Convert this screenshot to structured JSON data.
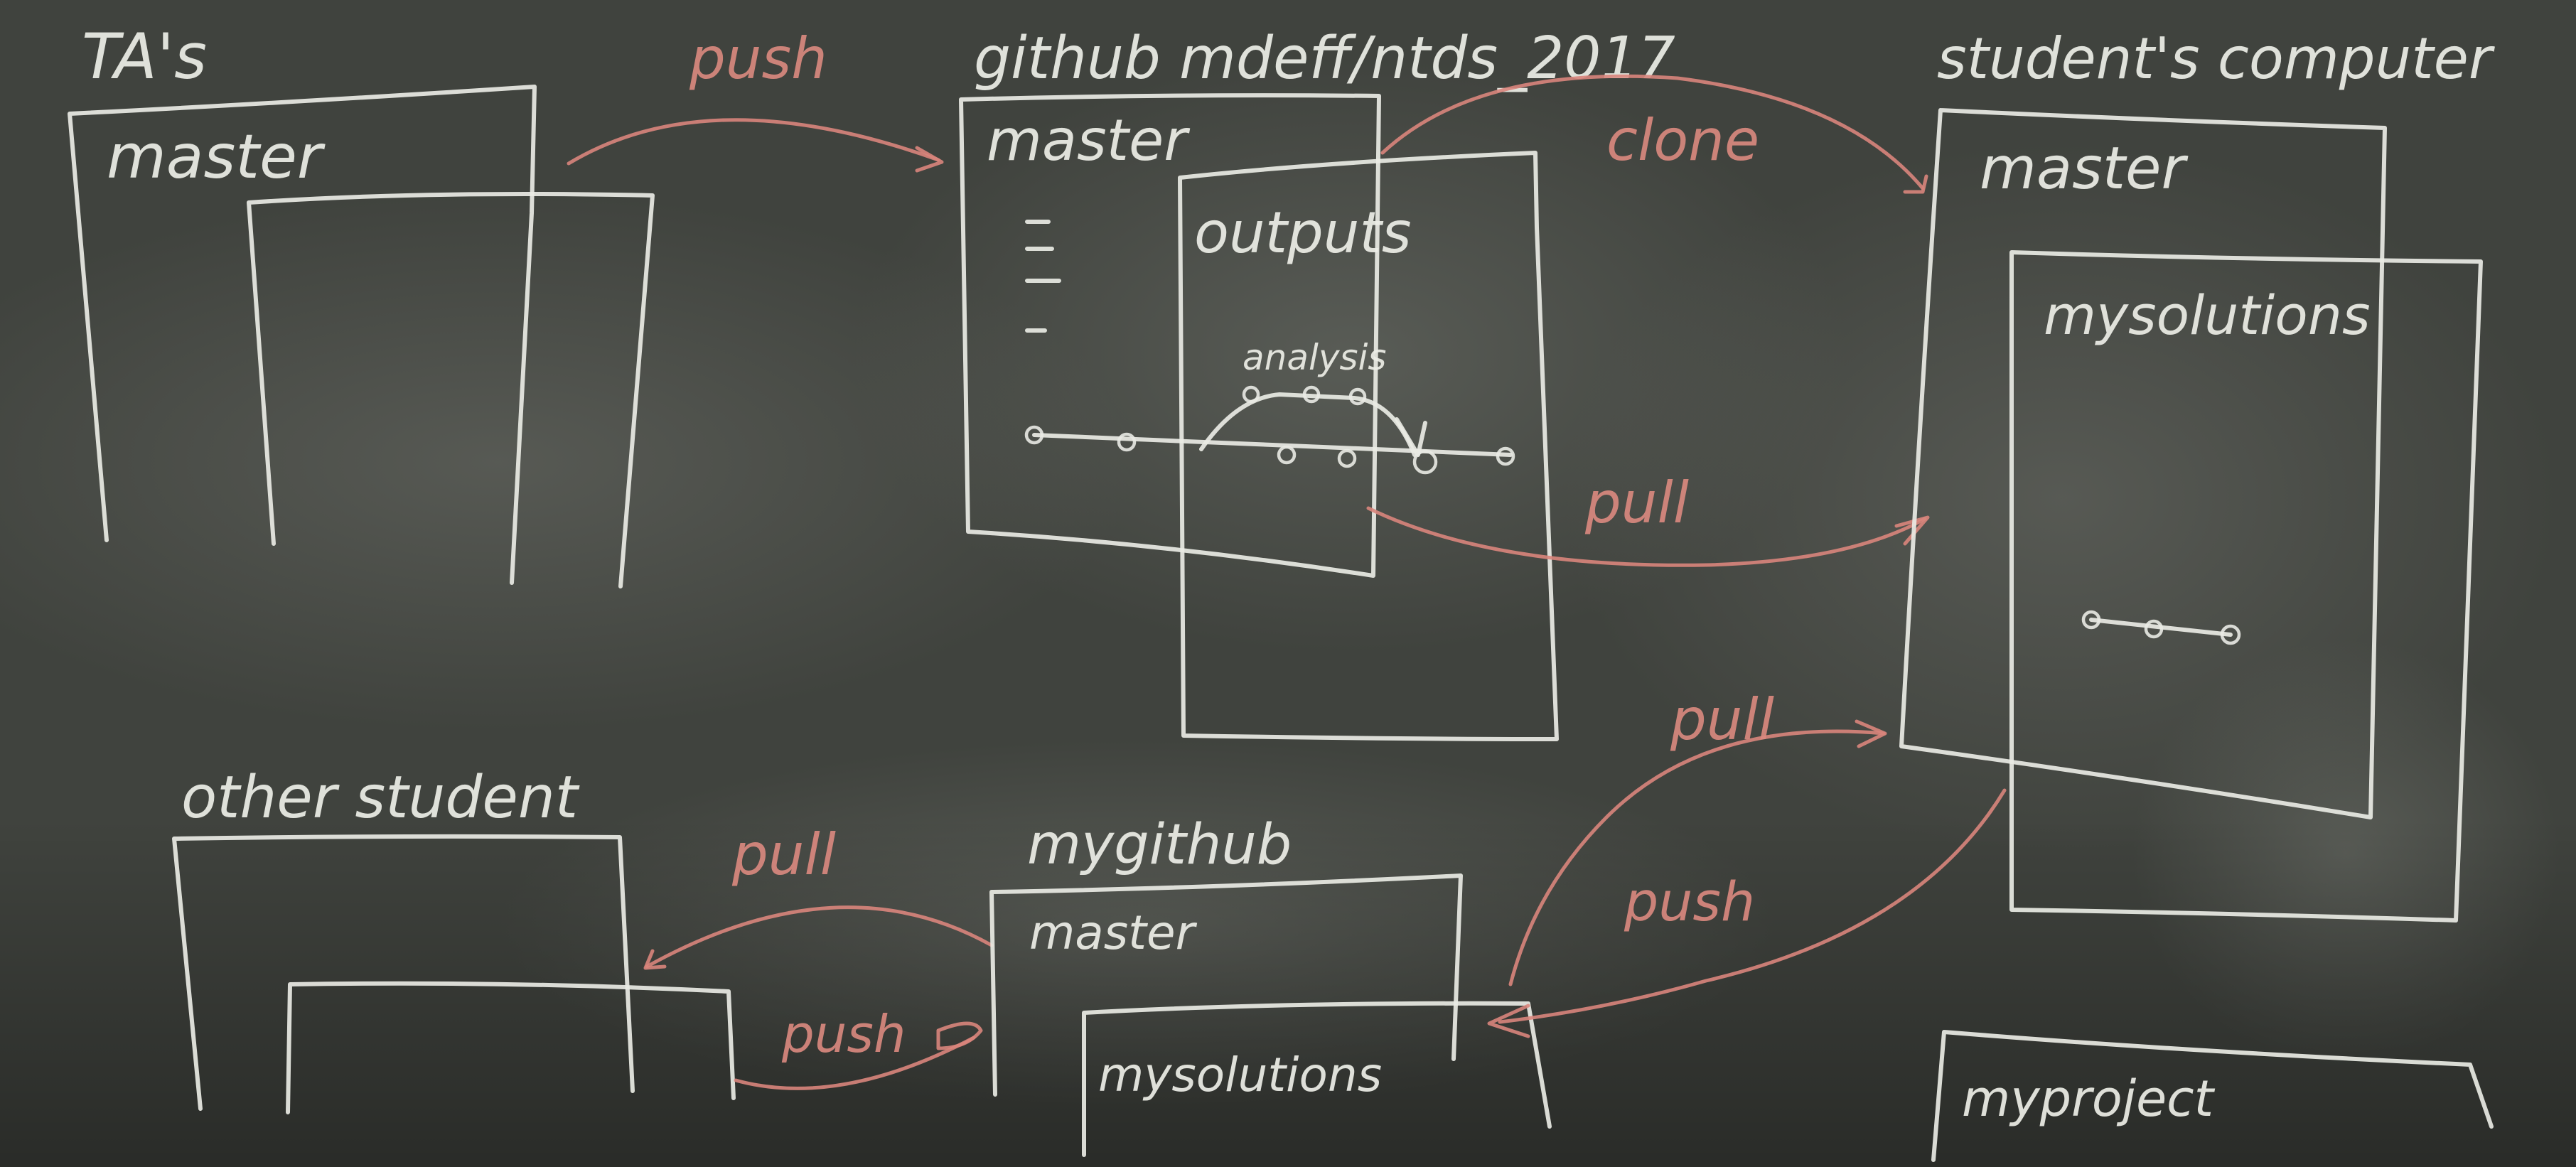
{
  "regions": {
    "ta": {
      "title": "TA's",
      "branch": "master"
    },
    "github_course": {
      "title": "github mdeff/ntds_2017",
      "branch": "master",
      "sub_branch": "outputs",
      "side_branch": "analysis"
    },
    "students_computer": {
      "title": "student's computer",
      "branch": "master",
      "sub_branch": "mysolutions",
      "project": "myproject"
    },
    "other_student": {
      "title": "other student"
    },
    "my_github": {
      "title": "mygithub",
      "branch": "master",
      "sub_branch": "mysolutions"
    }
  },
  "arrows": {
    "ta_to_github": "push",
    "github_to_computer_clone": "clone",
    "github_to_computer_pull": "pull",
    "mygithub_from_computer_pull": "pull",
    "computer_to_mygithub_push": "push",
    "other_student_pull": "pull",
    "other_student_push": "push"
  },
  "colors": {
    "board": "#3f423d",
    "chalk_white": "#e9eae4",
    "chalk_red": "#d9857c"
  }
}
